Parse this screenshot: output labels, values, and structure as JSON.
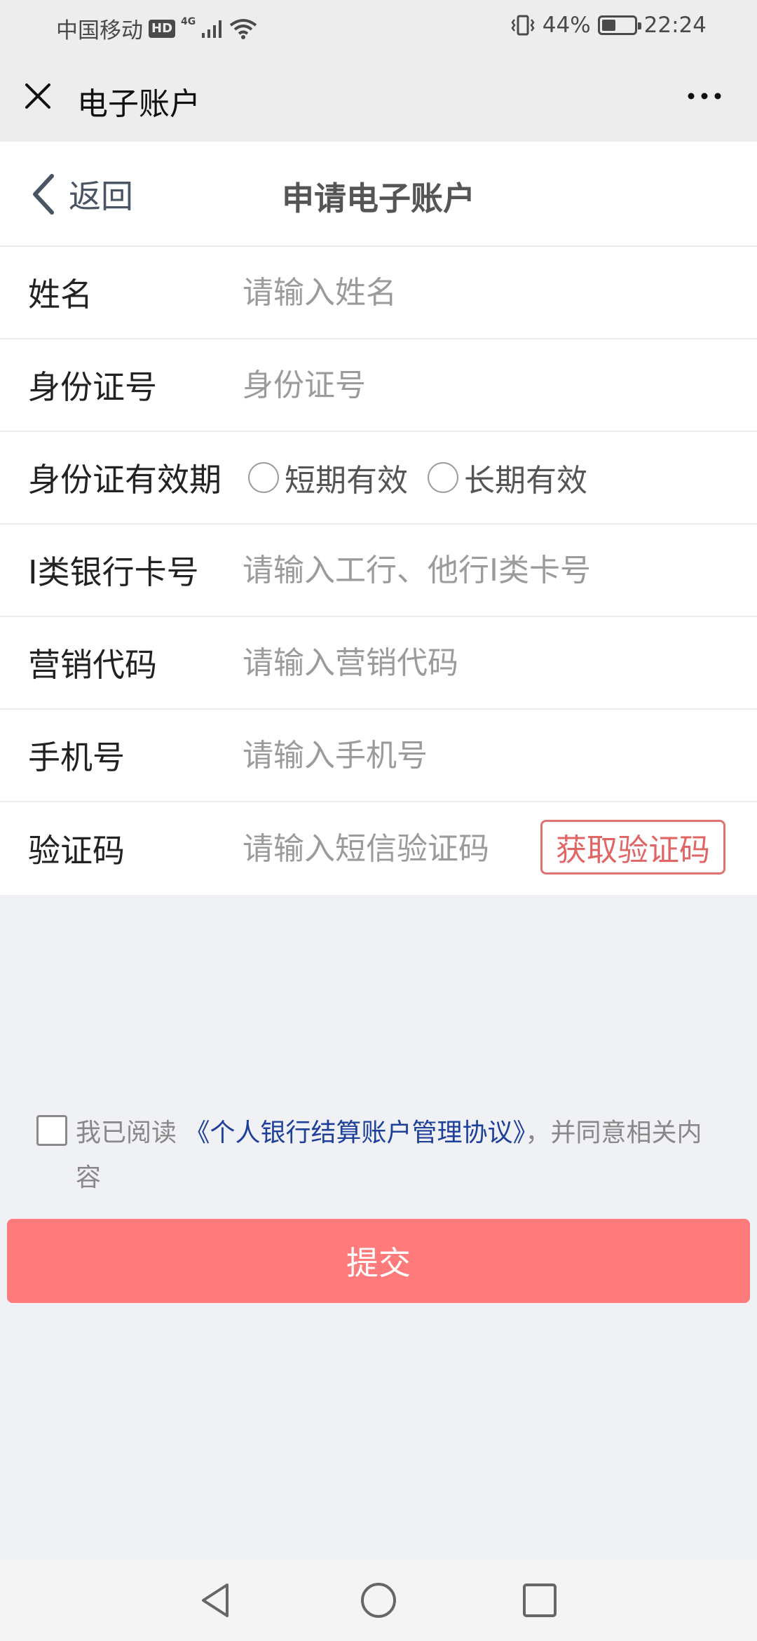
{
  "status_bar": {
    "carrier": "中国移动",
    "hd": "HD",
    "network": "4G",
    "battery_percent": "44%",
    "battery_level": 0.44,
    "time": "22:24"
  },
  "wx_header": {
    "title": "电子账户",
    "close_icon": "close-icon",
    "more_icon": "more-dots-icon"
  },
  "page_header": {
    "back_label": "返回",
    "title": "申请电子账户"
  },
  "form": {
    "name": {
      "label": "姓名",
      "placeholder": "请输入姓名"
    },
    "id_number": {
      "label": "身份证号",
      "placeholder": "身份证号"
    },
    "id_validity": {
      "label": "身份证有效期",
      "options": [
        "短期有效",
        "长期有效"
      ]
    },
    "bank_card": {
      "label": "I类银行卡号",
      "placeholder": "请输入工行、他行I类卡号"
    },
    "marketing_code": {
      "label": "营销代码",
      "placeholder": "请输入营销代码"
    },
    "phone": {
      "label": "手机号",
      "placeholder": "请输入手机号"
    },
    "sms_code": {
      "label": "验证码",
      "placeholder": "请输入短信验证码",
      "button": "获取验证码"
    }
  },
  "agreement": {
    "prefix": "我已阅读",
    "link": "《个人银行结算账户管理协议》",
    "suffix": "，并同意相关内容"
  },
  "submit_label": "提交",
  "colors": {
    "accent": "#ff7a7a",
    "sms_button": "#e06666",
    "link": "#1e3f9a"
  }
}
